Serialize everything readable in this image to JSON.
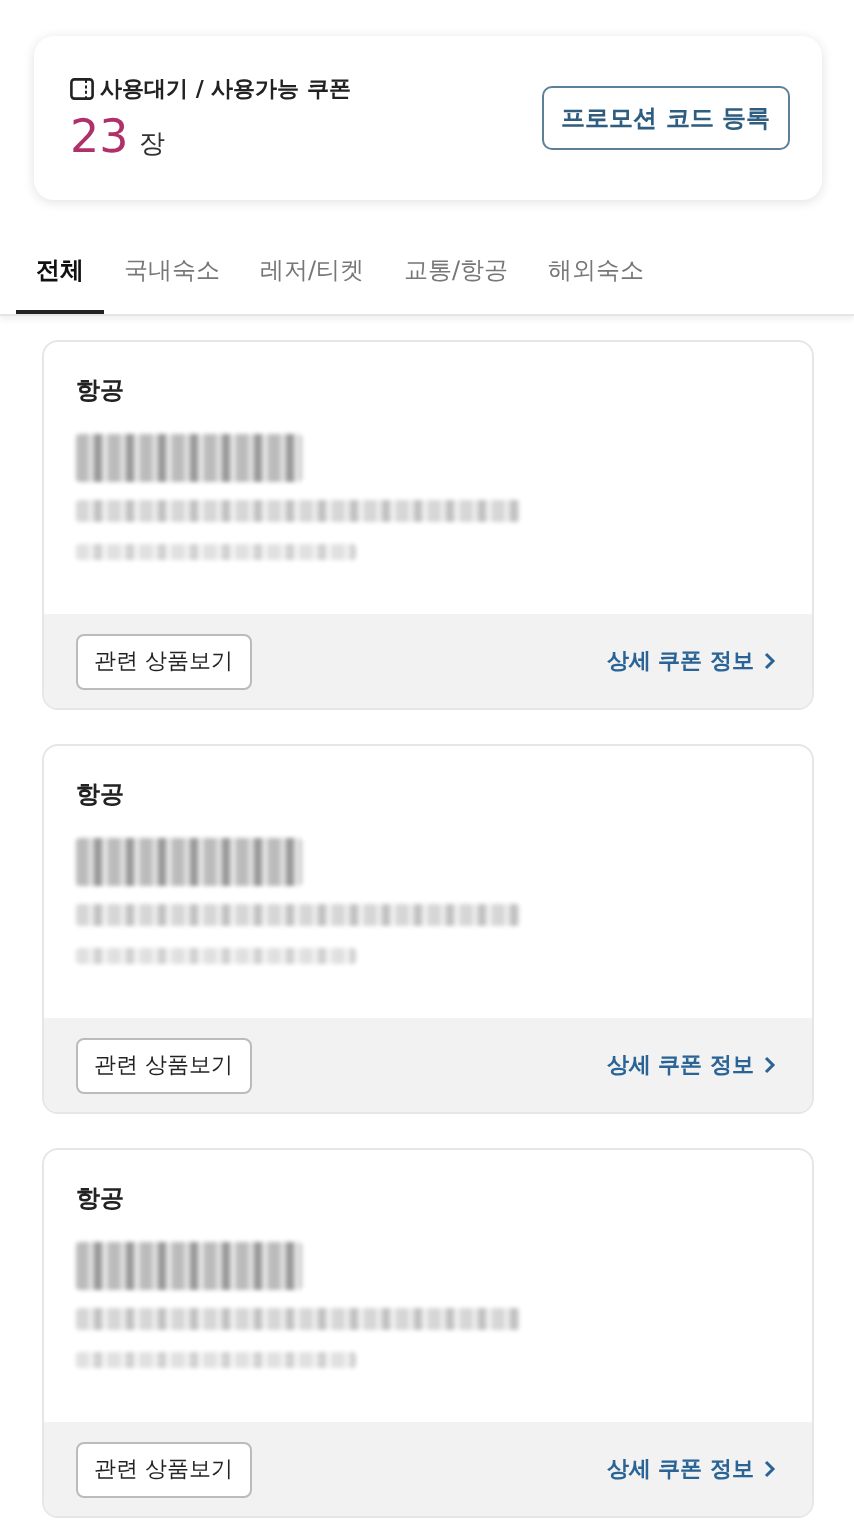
{
  "summary": {
    "label": "사용대기 / 사용가능 쿠폰",
    "count": "23",
    "unit": "장",
    "button": "프로모션 코드 등록"
  },
  "tabs": [
    {
      "label": "전체",
      "selected": true
    },
    {
      "label": "국내숙소",
      "selected": false
    },
    {
      "label": "레저/티켓",
      "selected": false
    },
    {
      "label": "교통/항공",
      "selected": false
    },
    {
      "label": "해외숙소",
      "selected": false
    }
  ],
  "coupons": [
    {
      "category": "항공",
      "button": "관련 상품보기",
      "link": "상세 쿠폰 정보"
    },
    {
      "category": "항공",
      "button": "관련 상품보기",
      "link": "상세 쿠폰 정보"
    },
    {
      "category": "항공",
      "button": "관련 상품보기",
      "link": "상세 쿠폰 정보"
    }
  ]
}
